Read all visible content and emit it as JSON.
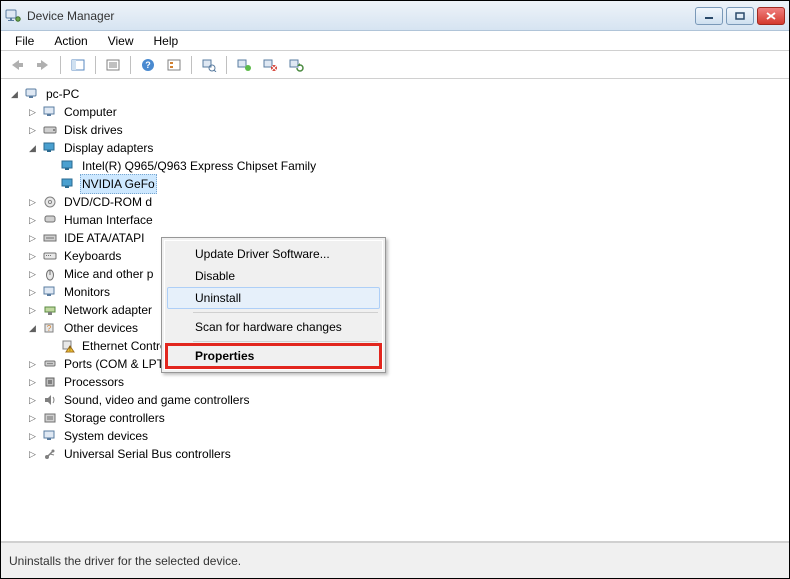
{
  "window": {
    "title": "Device Manager"
  },
  "menu": {
    "file": "File",
    "action": "Action",
    "view": "View",
    "help": "Help"
  },
  "tree": {
    "root": "pc-PC",
    "computer": "Computer",
    "disk_drives": "Disk drives",
    "display_adapters": "Display adapters",
    "da_intel": "Intel(R)  Q965/Q963 Express Chipset Family",
    "da_nvidia": "NVIDIA GeFo",
    "dvd": "DVD/CD-ROM d",
    "hid": "Human Interface",
    "ide": "IDE ATA/ATAPI",
    "keyboards": "Keyboards",
    "mice": "Mice and other p",
    "monitors": "Monitors",
    "network": "Network adapter",
    "other_devices": "Other devices",
    "ethernet_ctrl": "Ethernet Controller",
    "ports": "Ports (COM & LPT)",
    "processors": "Processors",
    "sound": "Sound, video and game controllers",
    "storage": "Storage controllers",
    "system": "System devices",
    "usb": "Universal Serial Bus controllers"
  },
  "context_menu": {
    "update": "Update Driver Software...",
    "disable": "Disable",
    "uninstall": "Uninstall",
    "scan": "Scan for hardware changes",
    "properties": "Properties"
  },
  "status": "Uninstalls the driver for the selected device."
}
